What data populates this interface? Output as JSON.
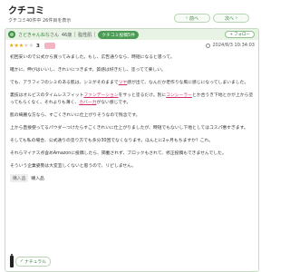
{
  "header": {
    "title": "クチコミ",
    "summary": "クチコミ40件中 26件目を表示",
    "prev_label": "前へ",
    "next_label": "次へ"
  },
  "review": {
    "user_name": "さどきゃんねな",
    "user_suffix": "さん",
    "age": "46歳",
    "skin_type": "脂性肌",
    "badge_label": "クチコミ投稿5件",
    "follow_label": "フォロー",
    "rating": 3,
    "rating_text": "3",
    "date": "2024/8/3 10:34:03",
    "paragraphs": [
      [
        "初回安いので公式から買ってみました。もし、広告通りなら、時短になると思って。"
      ],
      [
        "確かに、伸びはいいし、きれいにつきます。質感は好きだし、塗ってて楽しい。"
      ],
      [
        "でも、アラフィフのシミのある肌は、シミがそのままで",
        {
          "hl": "ツヤ"
        },
        "感が出て、なんだか老作りな風に感じになってしまいました。"
      ],
      [
        "裏技はオルビスのタイムレスフィット",
        {
          "hl": "ファンデーション"
        },
        "をサッと塗るだけ。別に",
        {
          "hl": "コンシーラー"
        },
        "とか合うき下地とかが上から塗ってもらくなく、それよりも薄く、",
        {
          "hl": "カバー力"
        },
        "がない感じです。"
      ],
      [
        "肌の綺麗な方なら、すごくきれいに仕上がりそうなので残念です。"
      ],
      [
        "上から直接使ってるパウダーつけたらすごくきれいに仕上がりましたが、時短でもないし下地としてはコスパ悪すぎます。"
      ],
      [
        "そしても私の場合、公式通りの塗り方でも多分30回でなくなります。ほんとに2ヶ月もちますか？これ。"
      ],
      [
        "それらマイナス点含めAmazonに投稿したら、掲載されず、ブロックもされて、修正投稿もできませんでした。"
      ],
      [
        "そういう企業姿勢は大変宜しくないと思うので、リピしません。"
      ]
    ],
    "tags": [
      {
        "label": "購入品",
        "value": "購入品"
      }
    ],
    "product_label": "ナチュラル"
  }
}
